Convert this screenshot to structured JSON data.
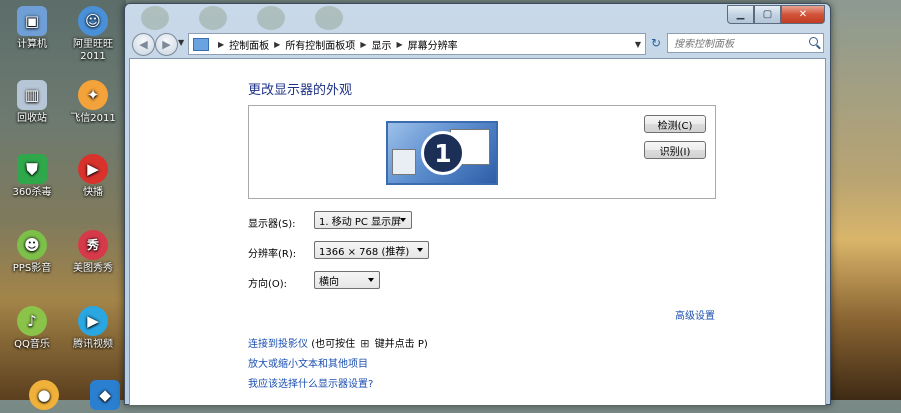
{
  "desktop": {
    "icons": [
      {
        "label": "计算机",
        "glyph": "▣",
        "color": "#6f9fd6"
      },
      {
        "label": "阿里旺旺\n2011",
        "glyph": "☺",
        "color": "#4a90d9"
      },
      {
        "label": "回收站",
        "glyph": "▥",
        "color": "#b7c6d6"
      },
      {
        "label": "飞信2011",
        "glyph": "✦",
        "color": "#f4a23a"
      },
      {
        "label": "360杀毒",
        "glyph": "⛊",
        "color": "#2ea84a"
      },
      {
        "label": "快播",
        "glyph": "▶",
        "color": "#d8322b"
      },
      {
        "label": "PPS影音",
        "glyph": "☻",
        "color": "#7cc04a"
      },
      {
        "label": "美图秀秀",
        "glyph": "秀",
        "color": "#d63a4a"
      },
      {
        "label": "QQ音乐",
        "glyph": "♪",
        "color": "#8bc34a"
      },
      {
        "label": "腾讯视频",
        "glyph": "▶",
        "color": "#2aa6e0"
      }
    ]
  },
  "window": {
    "caption": {
      "minimize": "▁",
      "maximize": "▢",
      "close": "✕"
    },
    "address": {
      "crumbs": [
        "控制面板",
        "所有控制面板项",
        "显示",
        "屏幕分辨率"
      ]
    },
    "search": {
      "placeholder": "搜索控制面板"
    },
    "content": {
      "heading": "更改显示器的外观",
      "monitor_number": "1",
      "detect_label": "检测(C)",
      "identify_label": "识别(I)",
      "display_label": "显示器(S):",
      "display_value": "1. 移动 PC 显示屏",
      "resolution_label": "分辨率(R):",
      "resolution_value": "1366 × 768 (推荐)",
      "orientation_label": "方向(O):",
      "orientation_value": "横向",
      "advanced_link": "高级设置",
      "projector_link": "连接到投影仪",
      "projector_hint_prefix": "(也可按住",
      "projector_hint_suffix": "键并点击 P)",
      "text_size_link": "放大或缩小文本和其他项目",
      "which_settings_link": "我应该选择什么显示器设置?"
    }
  }
}
